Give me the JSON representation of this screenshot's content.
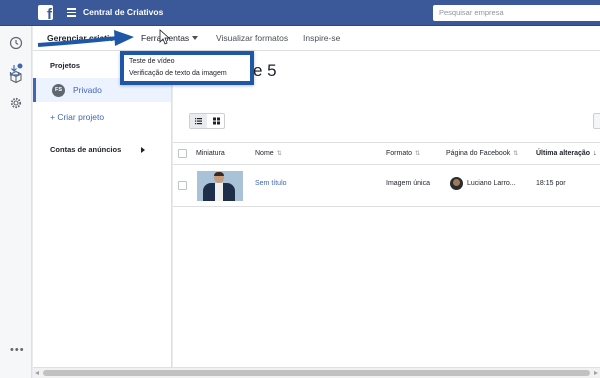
{
  "app": {
    "title": "Central de Criativos"
  },
  "search": {
    "placeholder": "Pesquisar empresa"
  },
  "nav": {
    "manage": "Gerenciar criativos",
    "tools": "Ferramentas",
    "view_formats": "Visualizar formatos",
    "inspire": "Inspire-se"
  },
  "tools_menu": {
    "items": [
      "Teste de vídeo",
      "Verificação de texto da imagem"
    ]
  },
  "sidebar": {
    "projects_heading": "Projetos",
    "project": {
      "initials": "FS",
      "label": "Privado"
    },
    "create_project": "+ Criar projeto",
    "ad_accounts": "Contas de anúncios"
  },
  "main": {
    "title_fragment": "e 5"
  },
  "table": {
    "headers": {
      "thumbnail": "Miniatura",
      "name": "Nome",
      "format": "Formato",
      "page": "Página do Facebook",
      "last_modified": "Última alteração"
    },
    "rows": [
      {
        "name": "Sem título",
        "format": "Imagem única",
        "page": "Luciano Larro...",
        "last_modified": "18:15 por"
      }
    ]
  },
  "colors": {
    "facebook_blue": "#3b5998",
    "link_blue": "#4267b2",
    "annotation_blue": "#1f57a8"
  },
  "icons": {
    "rail": [
      "clock-icon",
      "download-notification-icon",
      "cube-icon",
      "settings-gear-icon",
      "more-dots-icon"
    ],
    "view_toggle": [
      "list-view-icon",
      "grid-view-icon"
    ]
  }
}
